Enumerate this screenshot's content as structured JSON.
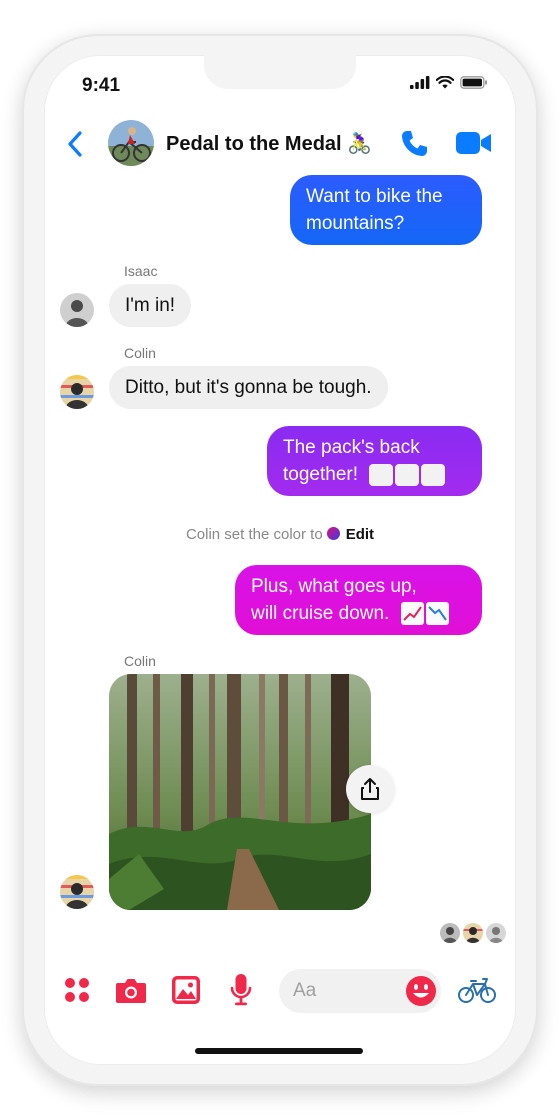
{
  "status_bar": {
    "time": "9:41"
  },
  "header": {
    "title": "Pedal to the Medal",
    "title_emoji": "🚴‍♀️"
  },
  "messages": [
    {
      "type": "outgoing",
      "text": "Want to bike the mountains?",
      "lines": [
        "Want to bike the",
        "mountains?"
      ],
      "color": "#1877f2"
    },
    {
      "type": "incoming",
      "sender": "Isaac",
      "text": "I'm in!"
    },
    {
      "type": "incoming",
      "sender": "Colin",
      "text": "Ditto, but it's gonna be tough."
    },
    {
      "type": "outgoing",
      "text": "The pack's back together! 🚴🚴🚴",
      "lines": [
        "The pack's back",
        "together!"
      ],
      "color": "#9b2cf0"
    },
    {
      "type": "system",
      "text": "Colin set the color to",
      "action": "Edit"
    },
    {
      "type": "outgoing",
      "text": "Plus, what goes up, will cruise down. 📈📉",
      "lines": [
        "Plus, what goes up,",
        "will cruise down."
      ],
      "color": "#e010e0"
    },
    {
      "type": "incoming_photo",
      "sender": "Colin",
      "photo": "forest-trail-photo"
    }
  ],
  "composer": {
    "placeholder": "Aa",
    "icons": [
      "apps-icon",
      "camera-icon",
      "gallery-icon",
      "microphone-icon",
      "emoji-icon",
      "bicycle-icon"
    ]
  },
  "theme": {
    "accent": "#f02849",
    "header_blue": "#0a7cff",
    "incoming_bg": "#efefef"
  }
}
